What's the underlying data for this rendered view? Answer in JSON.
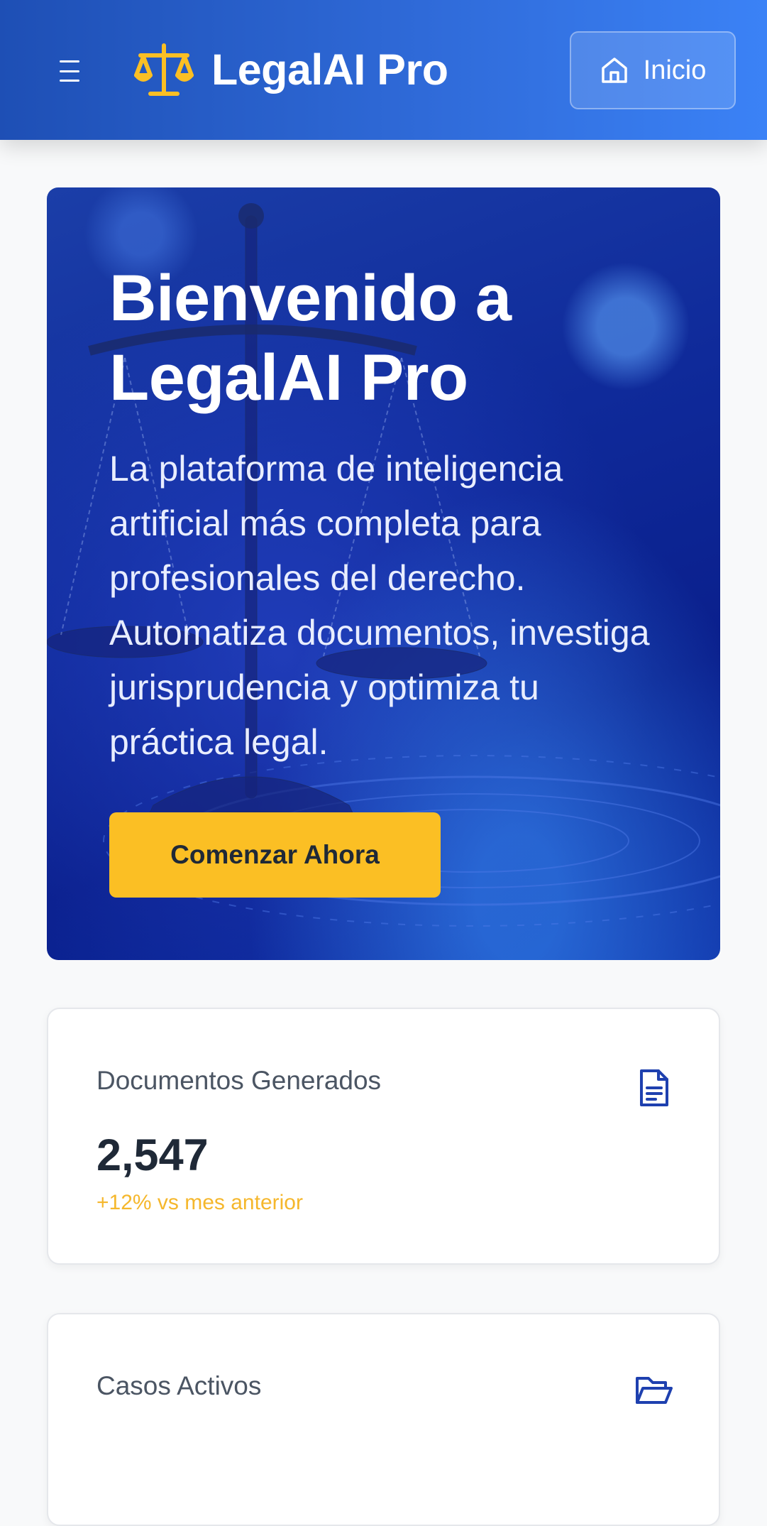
{
  "header": {
    "brand_name": "LegalAI Pro",
    "home_label": "Inicio",
    "menu_icon": "hamburger-menu-icon",
    "logo_icon": "scales-icon"
  },
  "hero": {
    "title": "Bienvenido a LegalAI Pro",
    "description": "La plataforma de inteligencia artificial más completa para profesionales del derecho. Automatiza documentos, investiga jurisprudencia y optimiza tu práctica legal.",
    "cta_label": "Comenzar Ahora"
  },
  "stats": [
    {
      "label": "Documentos Generados",
      "value": "2,547",
      "change": "+12% vs mes anterior",
      "icon": "document-icon"
    },
    {
      "label": "Casos Activos",
      "icon": "folder-open-icon"
    }
  ],
  "colors": {
    "header_start": "#1e4fb5",
    "header_end": "#3b82f6",
    "accent_gold": "#fbbf24",
    "icon_blue": "#1e40af",
    "text_dark": "#1f2937"
  }
}
